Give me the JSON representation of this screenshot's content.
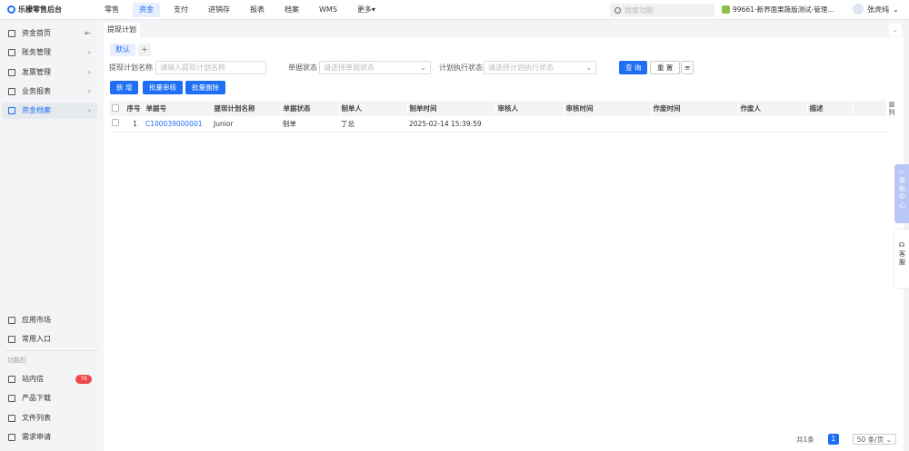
{
  "app": {
    "title": "乐檬零售后台"
  },
  "nav": [
    "零售",
    "资金",
    "支付",
    "进销存",
    "报表",
    "档案",
    "WMS",
    "更多▾"
  ],
  "nav_active": 1,
  "search": {
    "placeholder": "搜索功能"
  },
  "store": "99661-新界面果蔬版测试-管理...",
  "user": "张虎纯",
  "sidebar": {
    "items": [
      {
        "label": "资金首页",
        "arrow": "⇤"
      },
      {
        "label": "账务管理",
        "arrow": "›"
      },
      {
        "label": "发票管理",
        "arrow": "›"
      },
      {
        "label": "业务报表",
        "arrow": "›"
      },
      {
        "label": "资金档案",
        "arrow": "›"
      }
    ],
    "bottom": [
      {
        "label": "应用市场"
      },
      {
        "label": "常用入口"
      }
    ],
    "section": "功能栏",
    "func": [
      {
        "label": "站内信",
        "badge": "76"
      },
      {
        "label": "产品下载"
      },
      {
        "label": "文件列表"
      },
      {
        "label": "需求申请"
      }
    ]
  },
  "tab": "提现计划",
  "view_chip": "默认",
  "filters": {
    "name_label": "提现计划名称",
    "name_placeholder": "请输入提现计划名称",
    "status_label": "单据状态",
    "status_placeholder": "请选择单据状态",
    "exec_label": "计划执行状态",
    "exec_placeholder": "请选择计划执行状态"
  },
  "buttons": {
    "query": "查 询",
    "reset": "重 置",
    "add": "新 增",
    "batch_audit": "批量审核",
    "batch_delete": "批量删除"
  },
  "table": {
    "columns": [
      "序号",
      "单据号",
      "提现计划名称",
      "单据状态",
      "制单人",
      "制单时间",
      "审核人",
      "审核时间",
      "作废时间",
      "作废人",
      "描述"
    ],
    "rows": [
      [
        "1",
        "C100039000001",
        "Junior",
        "制单",
        "丁总",
        "2025-02-14 15:39:59",
        "",
        "",
        "",
        "",
        ""
      ]
    ]
  },
  "column_setting": "列",
  "pager": {
    "total": "共1条",
    "page": "1",
    "size": "50 条/页"
  },
  "help": "帮助中心",
  "service": "客服",
  "colors": {
    "accent": "#1e6ff5",
    "badge": "#f04848"
  }
}
